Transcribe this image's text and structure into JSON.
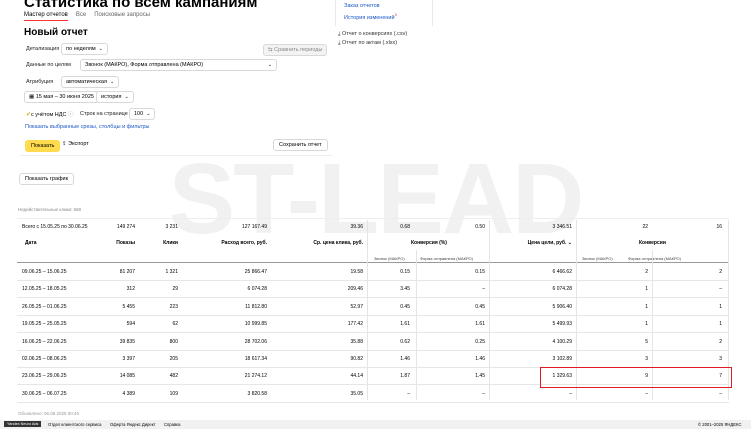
{
  "header": {
    "title": "Статистика по всем кампаниям"
  },
  "tabs": [
    {
      "label": "Мастер отчетов"
    },
    {
      "label": "Все"
    },
    {
      "label": "Поисковые запросы"
    }
  ],
  "right_links": {
    "orders": "Заказ отчетов",
    "history": "История изменений",
    "history_badge": "5",
    "conversions_report": "Отчет о конверсиях (.csv)",
    "acts_report": "Отчет по актам (.xlsx)"
  },
  "report": {
    "title": "Новый отчет",
    "detail_label": "Детализация",
    "detail_value": "по неделям",
    "compare_label": "Сравнить периоды",
    "goals_label": "Данные по целям",
    "goals_value": "Звонок (МАКРО), Форма отправлена (МАКРО)",
    "attribution_label": "Атрибуция",
    "attribution_value": "автоматическая",
    "period_value": "15 мая – 30 июня 2025",
    "history_value": "история",
    "vat_label": "с учётом НДС",
    "rows_label": "Строк на странице",
    "rows_value": "100",
    "show_slices_link": "Показать выбранные срезы, столбцы и фильтры",
    "show_button": "Показать",
    "export_button": "Экспорт",
    "save_button": "Сохранить отчет",
    "chart_button": "Показать график"
  },
  "watermark": "ST-LEAD",
  "table": {
    "invalid_clicks": "Недействительные клики: 568",
    "total": {
      "label": "Всего с 15.05.25 по 30.06.25",
      "shows": "149 274",
      "clicks": "3 231",
      "spend": "127 167.49",
      "cpc": "39.36",
      "conv1": "0.68",
      "conv2": "0.50",
      "cpa": "3 346.51",
      "cnt1": "22",
      "cnt2": "16"
    },
    "headers": {
      "date": "Дата",
      "shows": "Показы",
      "clicks": "Клики",
      "spend": "Расход всего, руб.",
      "cpc": "Ср. цена клика, руб.",
      "conversion": "Конверсия (%)",
      "cpa": "Цена цели, руб.",
      "conversions": "Конверсии",
      "sub_call": "Звонок (МАКРО)",
      "sub_form": "Форма отправлена (МАКРО)",
      "sub_call2": "Звонок (МАКРО)",
      "sub_form2": "Форма отправлена (МАКРО)"
    },
    "rows": [
      {
        "date": "09.06.25 – 15.06.25",
        "shows": "81 207",
        "clicks": "1 321",
        "spend": "25 866.47",
        "cpc": "19.58",
        "conv1": "0.15",
        "conv2": "0.15",
        "cpa": "6 466.62",
        "cnt1": "2",
        "cnt2": "2"
      },
      {
        "date": "12.05.25 – 18.05.25",
        "shows": "312",
        "clicks": "29",
        "spend": "6 074.28",
        "cpc": "209.46",
        "conv1": "3.45",
        "conv2": "–",
        "cpa": "6 074.28",
        "cnt1": "1",
        "cnt2": "–"
      },
      {
        "date": "26.05.25 – 01.06.25",
        "shows": "5 455",
        "clicks": "223",
        "spend": "11 812.80",
        "cpc": "52.97",
        "conv1": "0.45",
        "conv2": "0.45",
        "cpa": "5 906.40",
        "cnt1": "1",
        "cnt2": "1"
      },
      {
        "date": "19.05.25 – 25.05.25",
        "shows": "594",
        "clicks": "62",
        "spend": "10 999.85",
        "cpc": "177.42",
        "conv1": "1.61",
        "conv2": "1.61",
        "cpa": "5 499.93",
        "cnt1": "1",
        "cnt2": "1"
      },
      {
        "date": "16.06.25 – 22.06.25",
        "shows": "39 835",
        "clicks": "800",
        "spend": "28 702.06",
        "cpc": "35.88",
        "conv1": "0.62",
        "conv2": "0.25",
        "cpa": "4 100.29",
        "cnt1": "5",
        "cnt2": "2"
      },
      {
        "date": "02.06.25 – 08.06.25",
        "shows": "3 397",
        "clicks": "205",
        "spend": "18 617.34",
        "cpc": "90.82",
        "conv1": "1.46",
        "conv2": "1.46",
        "cpa": "3 102.89",
        "cnt1": "3",
        "cnt2": "3"
      },
      {
        "date": "23.06.25 – 29.06.25",
        "shows": "14 085",
        "clicks": "482",
        "spend": "21 274.12",
        "cpc": "44.14",
        "conv1": "1.87",
        "conv2": "1.45",
        "cpa": "1 329.63",
        "cnt1": "9",
        "cnt2": "7"
      },
      {
        "date": "30.06.25 – 06.07.25",
        "shows": "4 389",
        "clicks": "109",
        "spend": "3 820.58",
        "cpc": "35.05",
        "conv1": "–",
        "conv2": "–",
        "cpa": "–",
        "cnt1": "–",
        "cnt2": "–"
      }
    ],
    "updated": "Обновлено: 06.08.2025 00:45"
  },
  "footer": {
    "logo": "Yandex Neuro Ads",
    "links": [
      "Отдел клиентского сервиса",
      "Оферта Яндекс Директ",
      "Справка"
    ],
    "copyright": "© 2001–2025 ЯНДЕКС"
  },
  "colors": {
    "accent": "#ffdb4d",
    "link": "#1a57c4",
    "highlight": "#e21b22",
    "tab_underline": "#ff3333"
  }
}
